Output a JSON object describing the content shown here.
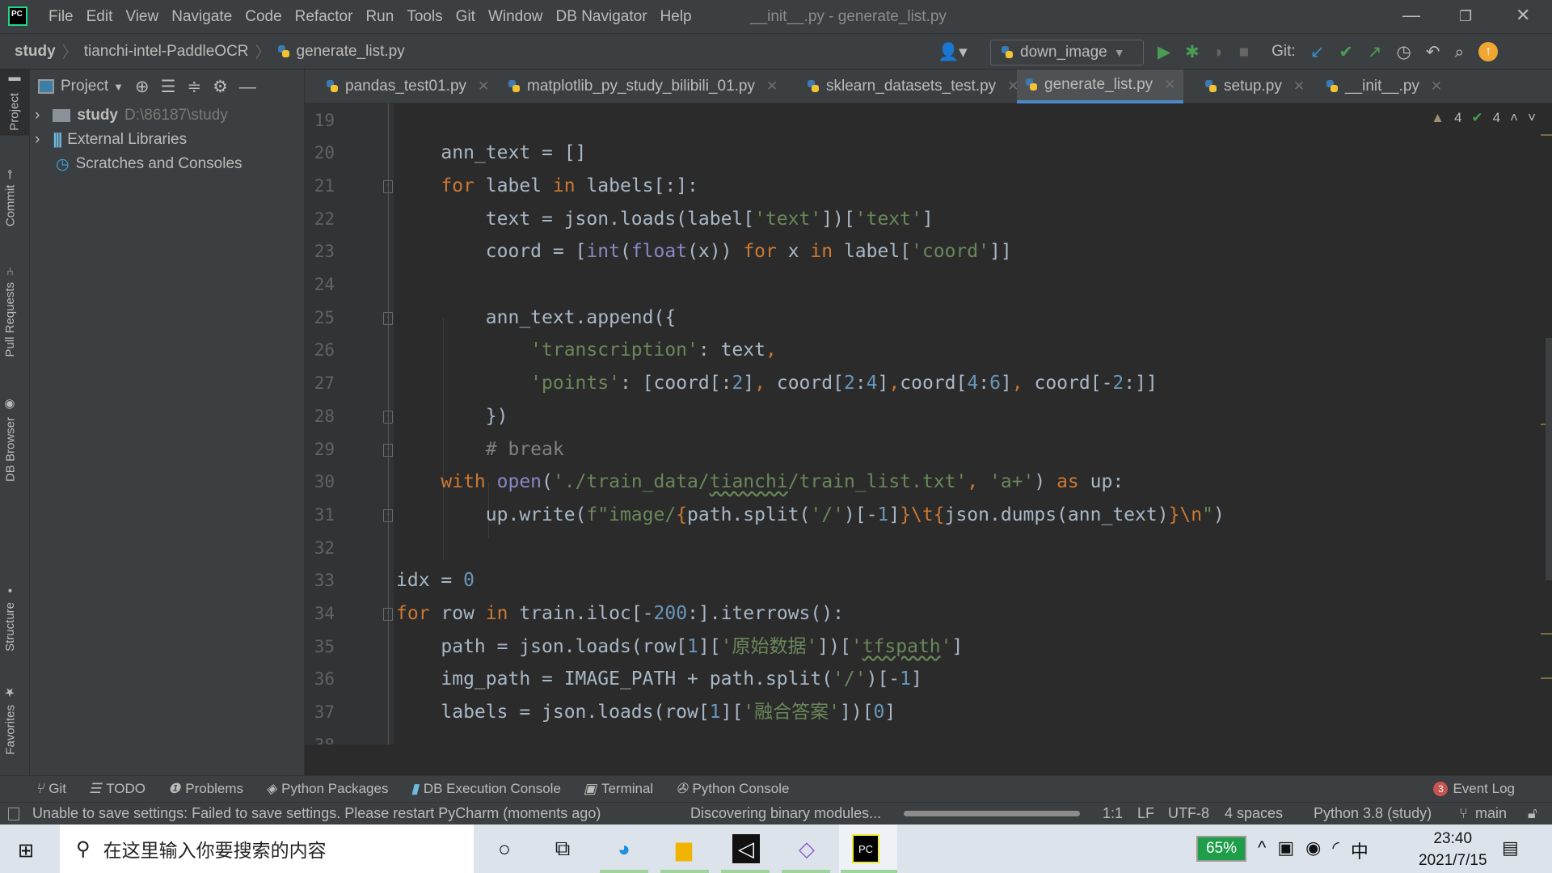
{
  "window": {
    "title": "__init__.py - generate_list.py",
    "app_logo": "PC"
  },
  "menu": [
    "File",
    "Edit",
    "View",
    "Navigate",
    "Code",
    "Refactor",
    "Run",
    "Tools",
    "Git",
    "Window",
    "DB Navigator",
    "Help"
  ],
  "breadcrumb": [
    "study",
    "tianchi-intel-PaddleOCR",
    "generate_list.py"
  ],
  "toolbar": {
    "run_config": "down_image",
    "git_label": "Git:"
  },
  "left_strip": [
    "Project",
    "Commit",
    "Pull Requests",
    "DB Browser",
    "Structure",
    "Favorites"
  ],
  "project_panel": {
    "title": "Project",
    "tree": [
      {
        "label": "study",
        "path": "D:\\86187\\study"
      },
      {
        "label": "External Libraries"
      },
      {
        "label": "Scratches and Consoles"
      }
    ]
  },
  "tabs": [
    {
      "label": "pandas_test01.py"
    },
    {
      "label": "matplotlib_py_study_bilibili_01.py"
    },
    {
      "label": "sklearn_datasets_test.py"
    },
    {
      "label": "generate_list.py",
      "active": true
    },
    {
      "label": "setup.py"
    },
    {
      "label": "__init__.py"
    }
  ],
  "inspections": {
    "warnings": "4",
    "weak_warnings": "4"
  },
  "code": {
    "first_line": 19,
    "lines": [
      [],
      [
        [
          "d",
          "    ann_text = []"
        ]
      ],
      [
        [
          "d",
          "    "
        ],
        [
          "kw",
          "for"
        ],
        [
          "d",
          " label "
        ],
        [
          "kw",
          "in"
        ],
        [
          "d",
          " labels[:]:"
        ]
      ],
      [
        [
          "d",
          "        text = json.loads(label["
        ],
        [
          "str",
          "'text'"
        ],
        [
          "d",
          "])["
        ],
        [
          "str",
          "'text'"
        ],
        [
          "d",
          "]"
        ]
      ],
      [
        [
          "d",
          "        coord = ["
        ],
        [
          "bi",
          "int"
        ],
        [
          "d",
          "("
        ],
        [
          "bi",
          "float"
        ],
        [
          "d",
          "(x)) "
        ],
        [
          "kw",
          "for"
        ],
        [
          "d",
          " x "
        ],
        [
          "kw",
          "in"
        ],
        [
          "d",
          " label["
        ],
        [
          "str",
          "'coord'"
        ],
        [
          "d",
          "]]"
        ]
      ],
      [],
      [
        [
          "d",
          "        ann_text.append({"
        ]
      ],
      [
        [
          "d",
          "            "
        ],
        [
          "str",
          "'transcription'"
        ],
        [
          "d",
          ": text"
        ],
        [
          "kw",
          ","
        ]
      ],
      [
        [
          "d",
          "            "
        ],
        [
          "str",
          "'points'"
        ],
        [
          "d",
          ": [coord[:"
        ],
        [
          "num",
          "2"
        ],
        [
          "d",
          "]"
        ],
        [
          "kw",
          ","
        ],
        [
          "d",
          " coord["
        ],
        [
          "num",
          "2"
        ],
        [
          "d",
          ":"
        ],
        [
          "num",
          "4"
        ],
        [
          "d",
          "]"
        ],
        [
          "kw",
          ","
        ],
        [
          "d",
          "coord["
        ],
        [
          "num",
          "4"
        ],
        [
          "d",
          ":"
        ],
        [
          "num",
          "6"
        ],
        [
          "d",
          "]"
        ],
        [
          "kw",
          ","
        ],
        [
          "d",
          " coord[-"
        ],
        [
          "num",
          "2"
        ],
        [
          "d",
          ":]]"
        ]
      ],
      [
        [
          "d",
          "        })"
        ]
      ],
      [
        [
          "com",
          "        # break"
        ]
      ],
      [
        [
          "d",
          "    "
        ],
        [
          "kw",
          "with"
        ],
        [
          "d",
          " "
        ],
        [
          "bi",
          "open"
        ],
        [
          "d",
          "("
        ],
        [
          "str",
          "'./train_data/"
        ],
        [
          "strw",
          "tianchi"
        ],
        [
          "str",
          "/train_list.txt'"
        ],
        [
          "kw",
          ","
        ],
        [
          "d",
          " "
        ],
        [
          "str",
          "'a+'"
        ],
        [
          "d",
          ") "
        ],
        [
          "kw",
          "as"
        ],
        [
          "d",
          " up:"
        ]
      ],
      [
        [
          "d",
          "        up.write("
        ],
        [
          "str",
          "f\"image/"
        ],
        [
          "br",
          "{"
        ],
        [
          "d",
          "path.split("
        ],
        [
          "str",
          "'/'"
        ],
        [
          "d",
          ")[-"
        ],
        [
          "num",
          "1"
        ],
        [
          "d",
          "]"
        ],
        [
          "br",
          "}"
        ],
        [
          "kw",
          "\\t"
        ],
        [
          "br",
          "{"
        ],
        [
          "d",
          "json.dumps(ann_text)"
        ],
        [
          "br",
          "}"
        ],
        [
          "kw",
          "\\n"
        ],
        [
          "str",
          "\""
        ],
        [
          "d",
          ")"
        ]
      ],
      [],
      [
        [
          "d",
          "idx = "
        ],
        [
          "num",
          "0"
        ]
      ],
      [
        [
          "kw",
          "for"
        ],
        [
          "d",
          " row "
        ],
        [
          "kw",
          "in"
        ],
        [
          "d",
          " train.iloc[-"
        ],
        [
          "num",
          "200"
        ],
        [
          "d",
          ":].iterrows():"
        ]
      ],
      [
        [
          "d",
          "    path = json.loads(row["
        ],
        [
          "num",
          "1"
        ],
        [
          "d",
          "]["
        ],
        [
          "str",
          "'原始数据'"
        ],
        [
          "d",
          "])["
        ],
        [
          "str",
          "'"
        ],
        [
          "strw",
          "tfspath"
        ],
        [
          "str",
          "'"
        ],
        [
          "d",
          "]"
        ]
      ],
      [
        [
          "d",
          "    img_path = IMAGE_PATH + path.split("
        ],
        [
          "str",
          "'/'"
        ],
        [
          "d",
          ")[-"
        ],
        [
          "num",
          "1"
        ],
        [
          "d",
          "]"
        ]
      ],
      [
        [
          "d",
          "    labels = json.loads(row["
        ],
        [
          "num",
          "1"
        ],
        [
          "d",
          "]["
        ],
        [
          "str",
          "'融合答案'"
        ],
        [
          "d",
          "])["
        ],
        [
          "num",
          "0"
        ],
        [
          "d",
          "]"
        ]
      ],
      []
    ]
  },
  "tool_windows": [
    "Git",
    "TODO",
    "Problems",
    "Python Packages",
    "DB Execution Console",
    "Terminal",
    "Python Console"
  ],
  "event_log": {
    "label": "Event Log",
    "count": "3"
  },
  "status": {
    "message": "Unable to save settings: Failed to save settings. Please restart PyCharm (moments ago)",
    "task": "Discovering binary modules...",
    "position": "1:1",
    "line_sep": "LF",
    "encoding": "UTF-8",
    "indent": "4 spaces",
    "interpreter": "Python 3.8 (study)",
    "branch": "main"
  },
  "taskbar": {
    "search_placeholder": "在这里输入你要搜索的内容",
    "battery": "65%",
    "ime": "中",
    "time": "23:40",
    "date": "2021/7/15"
  },
  "colors": {
    "keyword": "#cc7832",
    "string": "#6a8759",
    "number": "#6897bb",
    "builtin": "#8888c6",
    "comment": "#808080",
    "accent": "#4a88c7"
  }
}
